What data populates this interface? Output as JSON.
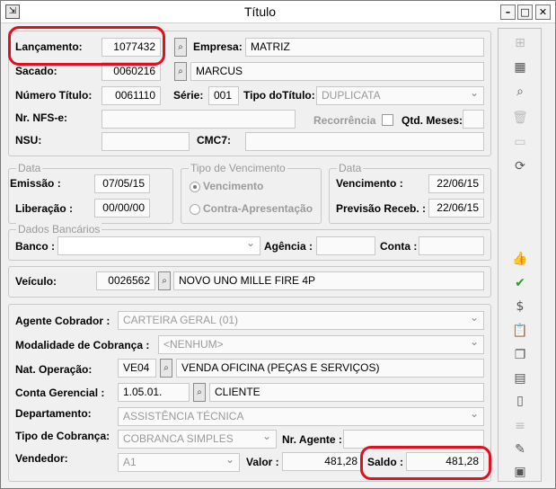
{
  "window": {
    "title": "Título",
    "icon": "app-icon",
    "min": "–",
    "max": "□",
    "close": "✕"
  },
  "form": {
    "lancamento": {
      "label": "Lançamento:",
      "value": "1077432"
    },
    "empresa": {
      "label": "Empresa:",
      "value": "MATRIZ"
    },
    "sacado": {
      "label": "Sacado:",
      "code": "0060216",
      "value": "MARCUS"
    },
    "numero_titulo": {
      "label": "Número Título:",
      "value": "0061110"
    },
    "serie": {
      "label": "Série:",
      "value": "001"
    },
    "tipo_titulo": {
      "label": "Tipo doTítulo:",
      "value": "DUPLICATA"
    },
    "nr_nfse": {
      "label": "Nr. NFS-e:",
      "value": ""
    },
    "recorrencia": {
      "label": "Recorrência",
      "checked": false
    },
    "qtd_meses": {
      "label": "Qtd. Meses:",
      "value": ""
    },
    "nsu": {
      "label": "NSU:",
      "value": ""
    },
    "cmc7": {
      "label": "CMC7:",
      "value": ""
    }
  },
  "data_group": {
    "title": "Data",
    "emissao_label": "Emissão :",
    "emissao": "07/05/15",
    "liberacao_label": "Liberação :",
    "liberacao": "00/00/00"
  },
  "venc_group": {
    "title": "Tipo de Vencimento",
    "opt1": "Vencimento",
    "opt2": "Contra-Apresentação",
    "selected": "Vencimento"
  },
  "data2_group": {
    "title": "Data",
    "vencimento_label": "Vencimento :",
    "vencimento": "22/06/15",
    "previsao_label": "Previsão Receb. :",
    "previsao": "22/06/15"
  },
  "bancarios": {
    "title": "Dados Bancários",
    "banco_label": "Banco :",
    "banco": "",
    "agencia_label": "Agência :",
    "agencia": "",
    "conta_label": "Conta :",
    "conta": ""
  },
  "veiculo": {
    "label": "Veículo:",
    "code": "0026562",
    "value": "NOVO UNO MILLE FIRE 4P"
  },
  "cobranca": {
    "agente_label": "Agente Cobrador :",
    "agente": "CARTEIRA GERAL (01)",
    "modalidade_label": "Modalidade de Cobrança :",
    "modalidade": "<NENHUM>",
    "nat_label": "Nat. Operação:",
    "nat_code": "VE04",
    "nat": "VENDA OFICINA (PEÇAS E SERVIÇOS)",
    "conta_label": "Conta Gerencial :",
    "conta_code": "1.05.01.",
    "conta": "CLIENTE",
    "depto_label": "Departamento:",
    "depto": "ASSISTÊNCIA TÉCNICA",
    "tipo_label": "Tipo de Cobrança:",
    "tipo": "COBRANCA SIMPLES",
    "nr_agente_label": "Nr. Agente :",
    "nr_agente": "",
    "vendedor_label": "Vendedor:",
    "vendedor": "A1",
    "valor_label": "Valor :",
    "valor": "481,28",
    "saldo_label": "Saldo :",
    "saldo": "481,28"
  },
  "toolbar": {
    "icons": [
      "tree-icon",
      "grid-add-icon",
      "preview-icon",
      "trash-icon",
      "folder-icon",
      "refresh-icon",
      "thumbs-up-icon",
      "check-icon",
      "money-bag-icon",
      "clipboard-icon",
      "copy-icon",
      "report-icon",
      "document-icon",
      "search-list-icon",
      "edit-icon",
      "calculator-icon"
    ]
  },
  "accent": {
    "highlight": "#e0101e"
  }
}
